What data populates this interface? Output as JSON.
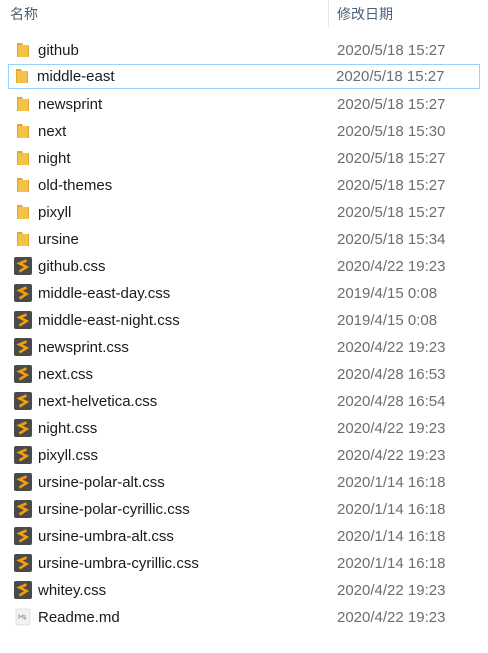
{
  "header": {
    "name_label": "名称",
    "date_label": "修改日期"
  },
  "colors": {
    "folder": "#f3c24b",
    "css_icon_bg": "#4a4a4a",
    "css_icon_s": "#f59e0b",
    "selection_border": "#99d1ff",
    "header_text": "#4c607a",
    "date_text": "#6d6d6d"
  },
  "files": [
    {
      "name": "github",
      "date": "2020/5/18 15:27",
      "icon": "folder-icon",
      "selected": false
    },
    {
      "name": "middle-east",
      "date": "2020/5/18 15:27",
      "icon": "folder-icon",
      "selected": true
    },
    {
      "name": "newsprint",
      "date": "2020/5/18 15:27",
      "icon": "folder-icon",
      "selected": false
    },
    {
      "name": "next",
      "date": "2020/5/18 15:30",
      "icon": "folder-icon",
      "selected": false
    },
    {
      "name": "night",
      "date": "2020/5/18 15:27",
      "icon": "folder-icon",
      "selected": false
    },
    {
      "name": "old-themes",
      "date": "2020/5/18 15:27",
      "icon": "folder-icon",
      "selected": false
    },
    {
      "name": "pixyll",
      "date": "2020/5/18 15:27",
      "icon": "folder-icon",
      "selected": false
    },
    {
      "name": "ursine",
      "date": "2020/5/18 15:34",
      "icon": "folder-icon",
      "selected": false
    },
    {
      "name": "github.css",
      "date": "2020/4/22 19:23",
      "icon": "css-file-icon",
      "selected": false
    },
    {
      "name": "middle-east-day.css",
      "date": "2019/4/15 0:08",
      "icon": "css-file-icon",
      "selected": false
    },
    {
      "name": "middle-east-night.css",
      "date": "2019/4/15 0:08",
      "icon": "css-file-icon",
      "selected": false
    },
    {
      "name": "newsprint.css",
      "date": "2020/4/22 19:23",
      "icon": "css-file-icon",
      "selected": false
    },
    {
      "name": "next.css",
      "date": "2020/4/28 16:53",
      "icon": "css-file-icon",
      "selected": false
    },
    {
      "name": "next-helvetica.css",
      "date": "2020/4/28 16:54",
      "icon": "css-file-icon",
      "selected": false
    },
    {
      "name": "night.css",
      "date": "2020/4/22 19:23",
      "icon": "css-file-icon",
      "selected": false
    },
    {
      "name": "pixyll.css",
      "date": "2020/4/22 19:23",
      "icon": "css-file-icon",
      "selected": false
    },
    {
      "name": "ursine-polar-alt.css",
      "date": "2020/1/14 16:18",
      "icon": "css-file-icon",
      "selected": false
    },
    {
      "name": "ursine-polar-cyrillic.css",
      "date": "2020/1/14 16:18",
      "icon": "css-file-icon",
      "selected": false
    },
    {
      "name": "ursine-umbra-alt.css",
      "date": "2020/1/14 16:18",
      "icon": "css-file-icon",
      "selected": false
    },
    {
      "name": "ursine-umbra-cyrillic.css",
      "date": "2020/1/14 16:18",
      "icon": "css-file-icon",
      "selected": false
    },
    {
      "name": "whitey.css",
      "date": "2020/4/22 19:23",
      "icon": "css-file-icon",
      "selected": false
    },
    {
      "name": "Readme.md",
      "date": "2020/4/22 19:23",
      "icon": "markdown-file-icon",
      "selected": false
    }
  ]
}
